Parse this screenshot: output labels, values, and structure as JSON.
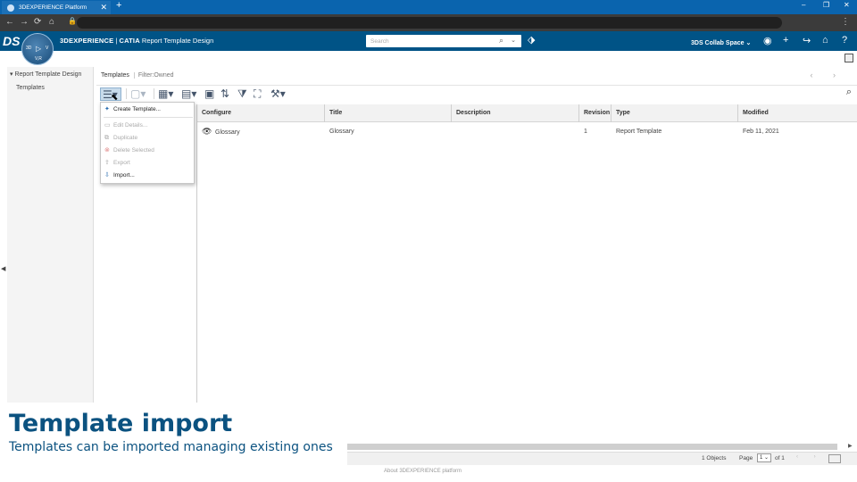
{
  "browser": {
    "tab_title": "3DEXPERIENCE Platform",
    "tab_close": "✕",
    "new_tab": "+",
    "controls": {
      "minimize": "–",
      "restore": "❐",
      "close": "✕"
    },
    "nav": {
      "back": "←",
      "forward": "→",
      "reload": "⟳",
      "home": "⌂",
      "lock": "🔒",
      "menu": "⋮"
    }
  },
  "topbar": {
    "logo": "DS",
    "compass": {
      "top": "3D",
      "play": "▷",
      "right": "V",
      "bottom": "V,R"
    },
    "brand_3dx": "3DEXPERIENCE",
    "brand_sep": " | ",
    "brand_catia": "CATIA",
    "app_name": "Report Template Design",
    "search_placeholder": "Search",
    "search_icon": "⌕",
    "search_dropdown": "⌄",
    "tag_icon": "⌂",
    "collab_space": "3DS Collab Space ⌄",
    "icons": {
      "user": "◉",
      "add": "+",
      "share": "↪",
      "home": "⌂",
      "help": "?"
    }
  },
  "tree": {
    "root_label": "Report Template Design",
    "root_arrow": "▾",
    "child_label": "Templates",
    "collapse_arrow": "◀"
  },
  "header": {
    "breadcrumb": "Templates",
    "filter": "Filter:Owned",
    "prev_next": "‹ ›"
  },
  "toolbar": {
    "actions": "☰▾",
    "new_doc": "▢▾",
    "edit_table": "▦▾",
    "view": "▤▾",
    "approve": "▣",
    "sort": "⇅",
    "filter": "⧩",
    "fit": "⛶",
    "tools": "⚒▾",
    "zoom_search": "⌕"
  },
  "menu": {
    "items": [
      {
        "icon": "✦",
        "label": "Create Template...",
        "enabled": true
      },
      {
        "icon": "▭",
        "label": "Edit Details...",
        "enabled": false
      },
      {
        "icon": "⧉",
        "label": "Duplicate",
        "enabled": false
      },
      {
        "icon": "⊗",
        "label": "Delete Selected",
        "enabled": false
      },
      {
        "icon": "⇪",
        "label": "Export",
        "enabled": false
      },
      {
        "icon": "⇩",
        "label": "Import...",
        "enabled": true
      }
    ]
  },
  "grid": {
    "columns": [
      "Configure",
      "Title",
      "Description",
      "Revision",
      "Type",
      "Modified"
    ],
    "rows": [
      {
        "configure": "Glossary",
        "title": "Glossary",
        "description": "",
        "revision": "1",
        "type": "Report Template",
        "modified": "Feb 11, 2021"
      }
    ]
  },
  "status": {
    "objects": "1 Objects",
    "page_label": "Page",
    "page_value": "1 ⌄",
    "of_label": "of 1",
    "arrows": "‹ ›"
  },
  "footer": {
    "about": "About 3DEXPERIENCE platform"
  },
  "caption": {
    "title": "Template import",
    "subtitle": "Templates can be imported managing existing ones"
  }
}
